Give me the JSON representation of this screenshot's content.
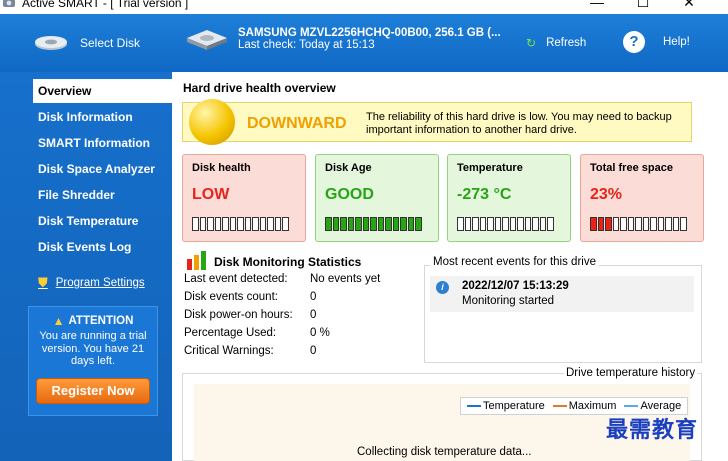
{
  "window": {
    "title": "Active SMART - [ Trial version ]",
    "minimize_glyph": "—",
    "maximize_glyph": "☐",
    "close_glyph": "✕"
  },
  "toolbar": {
    "select_disk": "Select Disk",
    "drive_name": "SAMSUNG MZVL2256HCHQ-00B00, 256.1 GB (...",
    "last_check": "Last check: Today at 15:13",
    "refresh": "Refresh",
    "help": "Help!",
    "refresh_icon": "refresh-icon",
    "help_icon": "question-icon"
  },
  "sidebar": {
    "items": [
      {
        "label": "Overview",
        "active": true
      },
      {
        "label": "Disk Information",
        "active": false
      },
      {
        "label": "SMART Information",
        "active": false
      },
      {
        "label": "Disk Space Analyzer",
        "active": false
      },
      {
        "label": "File Shredder",
        "active": false
      },
      {
        "label": "Disk Temperature",
        "active": false
      },
      {
        "label": "Disk Events Log",
        "active": false
      }
    ],
    "settings": "Program Settings",
    "attention": {
      "title": "ATTENTION",
      "body": "You are running a trial version. You have 21 days left."
    },
    "register": "Register Now"
  },
  "main": {
    "title": "Hard drive health overview",
    "health_status": "DOWNWARD",
    "health_message": "The reliability of this hard drive is low. You may need to backup important information to another hard drive.",
    "cards": [
      {
        "title": "Disk health",
        "value": "LOW",
        "color": "#e8231a",
        "style": "red",
        "filled_segments": 0,
        "total_segments": 13
      },
      {
        "title": "Disk Age",
        "value": "GOOD",
        "color": "#27a615",
        "style": "green",
        "filled_segments": 13,
        "total_segments": 13
      },
      {
        "title": "Temperature",
        "value": "-273 °C",
        "color": "#27a615",
        "style": "green",
        "filled_segments": 0,
        "total_segments": 13
      },
      {
        "title": "Total free space",
        "value": "23%",
        "color": "#e8231a",
        "style": "red",
        "filled_segments": 3,
        "total_segments": 13
      }
    ],
    "stats": {
      "title": "Disk Monitoring Statistics",
      "rows": [
        {
          "label": "Last event detected:",
          "value": "No events yet"
        },
        {
          "label": "Disk events count:",
          "value": "0"
        },
        {
          "label": "Disk power-on hours:",
          "value": "0"
        },
        {
          "label": "Percentage Used:",
          "value": "0 %"
        },
        {
          "label": "Critical Warnings:",
          "value": "0"
        }
      ]
    },
    "events": {
      "title": "Most recent events for this drive",
      "items": [
        {
          "datetime": "2022/12/07 15:13:29",
          "text": "Monitoring started"
        }
      ]
    },
    "temperature_history": {
      "title": "Drive temperature history",
      "legend": [
        {
          "name": "Temperature",
          "color": "#1f6fd6"
        },
        {
          "name": "Maximum",
          "color": "#e8732a"
        },
        {
          "name": "Average",
          "color": "#5aa8e6"
        }
      ],
      "status": "Collecting disk temperature data..."
    }
  },
  "watermark": "最需教育",
  "colors": {
    "accent_blue": "#1670cc",
    "banner_yellow": "#fff9c2",
    "warning_orange": "#f0a000",
    "register_orange": "#f07a1a"
  }
}
